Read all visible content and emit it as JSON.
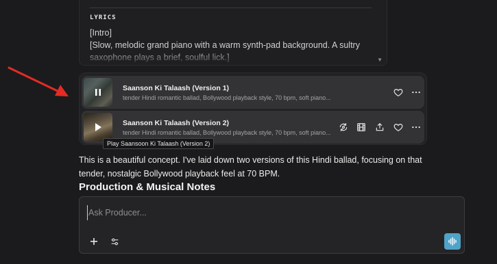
{
  "lyrics": {
    "heading": "LYRICS",
    "line1": "[Intro]",
    "line2": "[Slow, melodic grand piano with a warm synth-pad background. A sultry saxophone plays a brief, soulful lick.]"
  },
  "songs": [
    {
      "title": "Saanson Ki Talaash (Version 1)",
      "description": "tender Hindi romantic ballad, Bollywood playback style, 70 bpm, soft piano...",
      "state": "playing"
    },
    {
      "title": "Saanson Ki Talaash (Version 2)",
      "description": "tender Hindi romantic ballad, Bollywood playback style, 70 bpm, soft piano...",
      "state": "paused"
    }
  ],
  "tooltip": "Play Saansoon Ki Talaash (Version 2)",
  "message": "This is a beautiful concept. I've laid down two versions of this Hindi ballad, focusing on that tender, nostalgic Bollywood playback feel at 70 BPM.",
  "section_heading": "Production & Musical Notes",
  "composer": {
    "placeholder": "Ask Producer..."
  },
  "icons": {
    "remix": "remix-icon",
    "video": "film-icon",
    "share": "share-icon",
    "like": "heart-icon",
    "more": "more-icon",
    "add": "plus-icon",
    "settings": "sliders-icon",
    "voice": "waveform-icon"
  },
  "colors": {
    "background": "#1b1b1d",
    "annotation_arrow": "#e52b24",
    "voice_button": "#4fa3c9"
  }
}
